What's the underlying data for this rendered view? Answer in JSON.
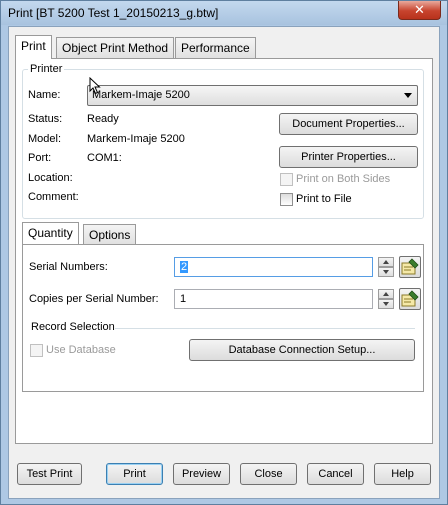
{
  "window": {
    "title": "Print [BT 5200 Test 1_20150213_g.btw]",
    "close_glyph": "✕"
  },
  "main_tabs": [
    {
      "label": "Print",
      "active": true
    },
    {
      "label": "Object Print Method",
      "active": false
    },
    {
      "label": "Performance",
      "active": false
    }
  ],
  "printer": {
    "group_label": "Printer",
    "name_label": "Name:",
    "name_value": "Markem-Imaje 5200",
    "status_label": "Status:",
    "status_value": "Ready",
    "model_label": "Model:",
    "model_value": "Markem-Imaje 5200",
    "port_label": "Port:",
    "port_value": "COM1:",
    "location_label": "Location:",
    "location_value": "",
    "comment_label": "Comment:",
    "comment_value": "",
    "document_properties_label": "Document Properties...",
    "printer_properties_label": "Printer Properties...",
    "print_both_sides_label": "Print on Both Sides",
    "print_both_sides_checked": false,
    "print_both_sides_enabled": false,
    "print_to_file_label": "Print to File",
    "print_to_file_checked": false
  },
  "sub_tabs": [
    {
      "label": "Quantity",
      "active": true
    },
    {
      "label": "Options",
      "active": false
    }
  ],
  "quantity": {
    "serial_numbers_label": "Serial Numbers:",
    "serial_numbers_value": "2",
    "copies_label": "Copies per Serial Number:",
    "copies_value": "1",
    "record_selection_label": "Record Selection",
    "use_database_label": "Use Database",
    "use_database_checked": false,
    "use_database_enabled": false,
    "database_setup_label": "Database Connection Setup..."
  },
  "footer": {
    "test_print_label": "Test Print",
    "print_label": "Print",
    "preview_label": "Preview",
    "close_label": "Close",
    "cancel_label": "Cancel",
    "help_label": "Help"
  },
  "colors": {
    "selection": "#3399ff",
    "title_bar": "#aec8e4",
    "close_button": "#c7432d"
  }
}
